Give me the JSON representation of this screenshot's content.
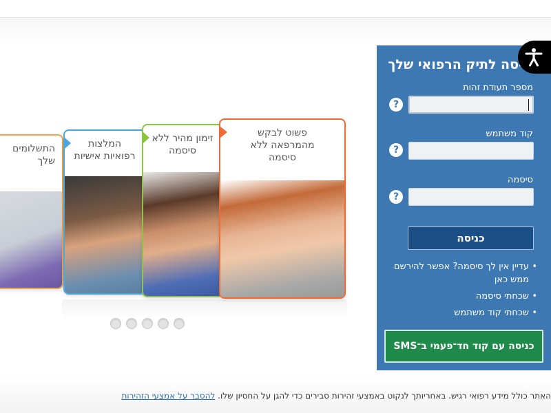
{
  "carousel": {
    "cards": [
      {
        "text": "התשלומים שלך"
      },
      {
        "text": "המלצות רפואיות אישיות"
      },
      {
        "text": "זימון מהיר ללא סיסמה"
      },
      {
        "text": "פשוט לבקש מהמרפאה ללא סיסמה"
      }
    ],
    "dot_count": 5
  },
  "login": {
    "title": "כניסה לתיק הרפואי שלך",
    "id_label": "מספר תעודת זהות",
    "id_value": "",
    "username_label": "קוד משתמש",
    "username_value": "",
    "password_label": "סיסמה",
    "password_value": "",
    "help_symbol": "?",
    "submit_label": "כניסה",
    "links": [
      "עדיין אין לך סיסמה? אפשר להירשם ממש כאן",
      "שכחתי סיסמה",
      "שכחתי קוד משתמש"
    ],
    "sms_label": "כניסה עם קוד חד־פעמי ב־SMS"
  },
  "accessibility": {
    "icon": "accessibility-icon"
  },
  "footer": {
    "text": "האתר כולל מידע רפואי רגיש. באחריותך לנקוט באמצעי זהירות סבירים כדי להגן על החסיון שלו. ",
    "link_text": "להסבר על אמצעי הזהירות"
  },
  "colors": {
    "panel": "#3e78b2",
    "submit": "#1c4f86",
    "sms": "#1f8a49",
    "card_orange": "#f06a35",
    "card_green": "#8cc63f",
    "card_blue": "#4aa6e0",
    "card_yellow": "#f0a64c"
  }
}
